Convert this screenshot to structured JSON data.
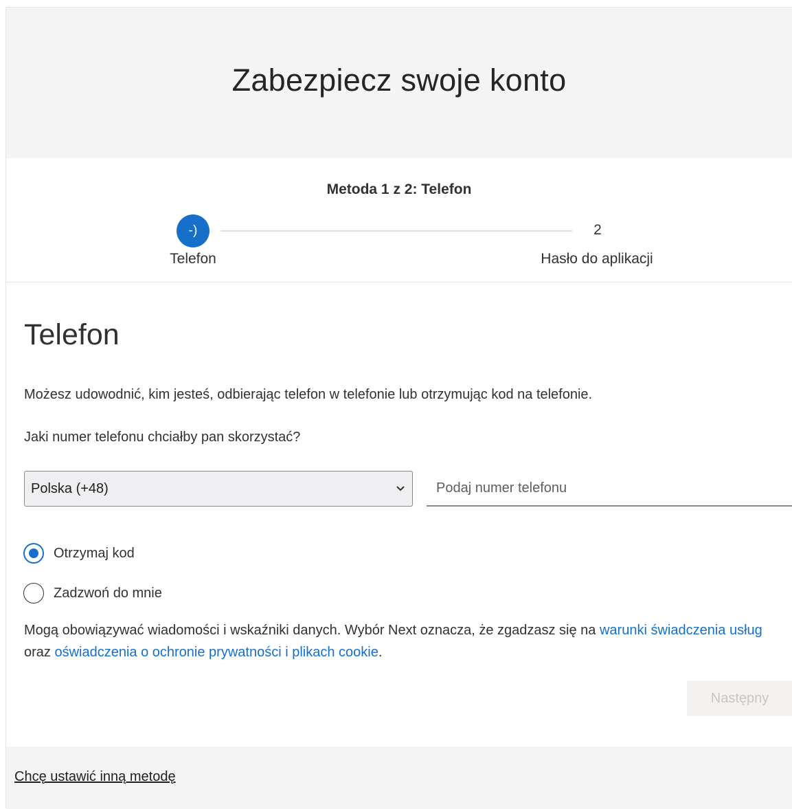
{
  "header": {
    "title": "Zabezpiecz swoje konto"
  },
  "stepper": {
    "caption": "Metoda 1 z 2: Telefon",
    "steps": [
      {
        "marker": "-)",
        "label": "Telefon",
        "state": "current"
      },
      {
        "marker": "2",
        "label": "Hasło do aplikacji",
        "state": "pending"
      }
    ]
  },
  "phone_section": {
    "title": "Telefon",
    "description": "Możesz udowodnić, kim jesteś, odbierając telefon w telefonie lub otrzymując kod na telefonie.",
    "question": "Jaki numer telefonu chciałby pan skorzystać?",
    "country_select": {
      "selected": "Polska (+48)"
    },
    "phone_input": {
      "value": "",
      "placeholder": "Podaj numer telefonu"
    },
    "options": [
      {
        "label": "Otrzymaj kod",
        "checked": true
      },
      {
        "label": "Zadzwoń do mnie",
        "checked": false
      }
    ],
    "legal": {
      "text_before": "Mogą obowiązywać wiadomości i wskaźniki danych. Wybór Next oznacza, że zgadzasz się na ",
      "terms_link": "warunki świadczenia usług",
      "text_middle": " oraz ",
      "privacy_link": "oświadczenia o ochronie prywatności i plikach cookie",
      "text_after": "."
    },
    "next_button": "Następny"
  },
  "footer": {
    "other_method_link": "Chcę ustawić inną metodę"
  },
  "colors": {
    "accent": "#1670c9",
    "header_bg": "#f4f4f4",
    "disabled_text": "#c8c6c4"
  },
  "icons": {
    "select_chevron": "chevron-down-icon"
  }
}
